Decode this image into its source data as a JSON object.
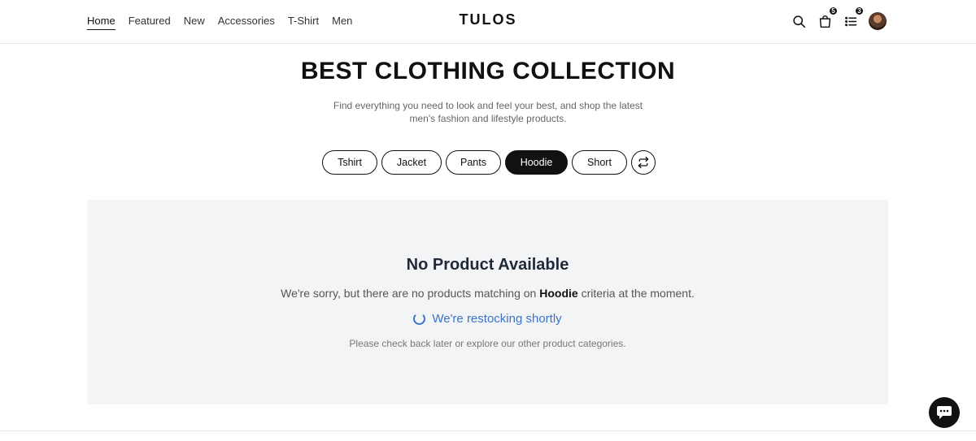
{
  "nav": {
    "items": [
      {
        "label": "Home",
        "active": true
      },
      {
        "label": "Featured",
        "active": false
      },
      {
        "label": "New",
        "active": false
      },
      {
        "label": "Accessories",
        "active": false
      },
      {
        "label": "T-Shirt",
        "active": false
      },
      {
        "label": "Men",
        "active": false
      }
    ]
  },
  "brand": "TULOS",
  "header_icons": {
    "search": "search-icon",
    "cart": {
      "icon": "shopping-bag-icon",
      "count": "5"
    },
    "list": {
      "icon": "list-icon",
      "count": "3"
    },
    "avatar": "user-avatar"
  },
  "hero": {
    "title": "BEST CLOTHING COLLECTION",
    "subtitle_line1": "Find everything you need to look and feel your best, and shop the latest",
    "subtitle_line2": "men's fashion and lifestyle products."
  },
  "categories": [
    {
      "label": "Tshirt",
      "active": false
    },
    {
      "label": "Jacket",
      "active": false
    },
    {
      "label": "Pants",
      "active": false
    },
    {
      "label": "Hoodie",
      "active": true
    },
    {
      "label": "Short",
      "active": false
    }
  ],
  "empty_state": {
    "title": "No Product Available",
    "message_prefix": "We're sorry, but there are no products matching on",
    "message_category": "Hoodie",
    "message_suffix": "criteria at the moment.",
    "restock": "We're restocking shortly",
    "hint": "Please check back later or explore our other product categories."
  },
  "colors": {
    "accent": "#111111",
    "link_blue": "#3b74c9",
    "panel_bg": "#f3f4f6"
  }
}
